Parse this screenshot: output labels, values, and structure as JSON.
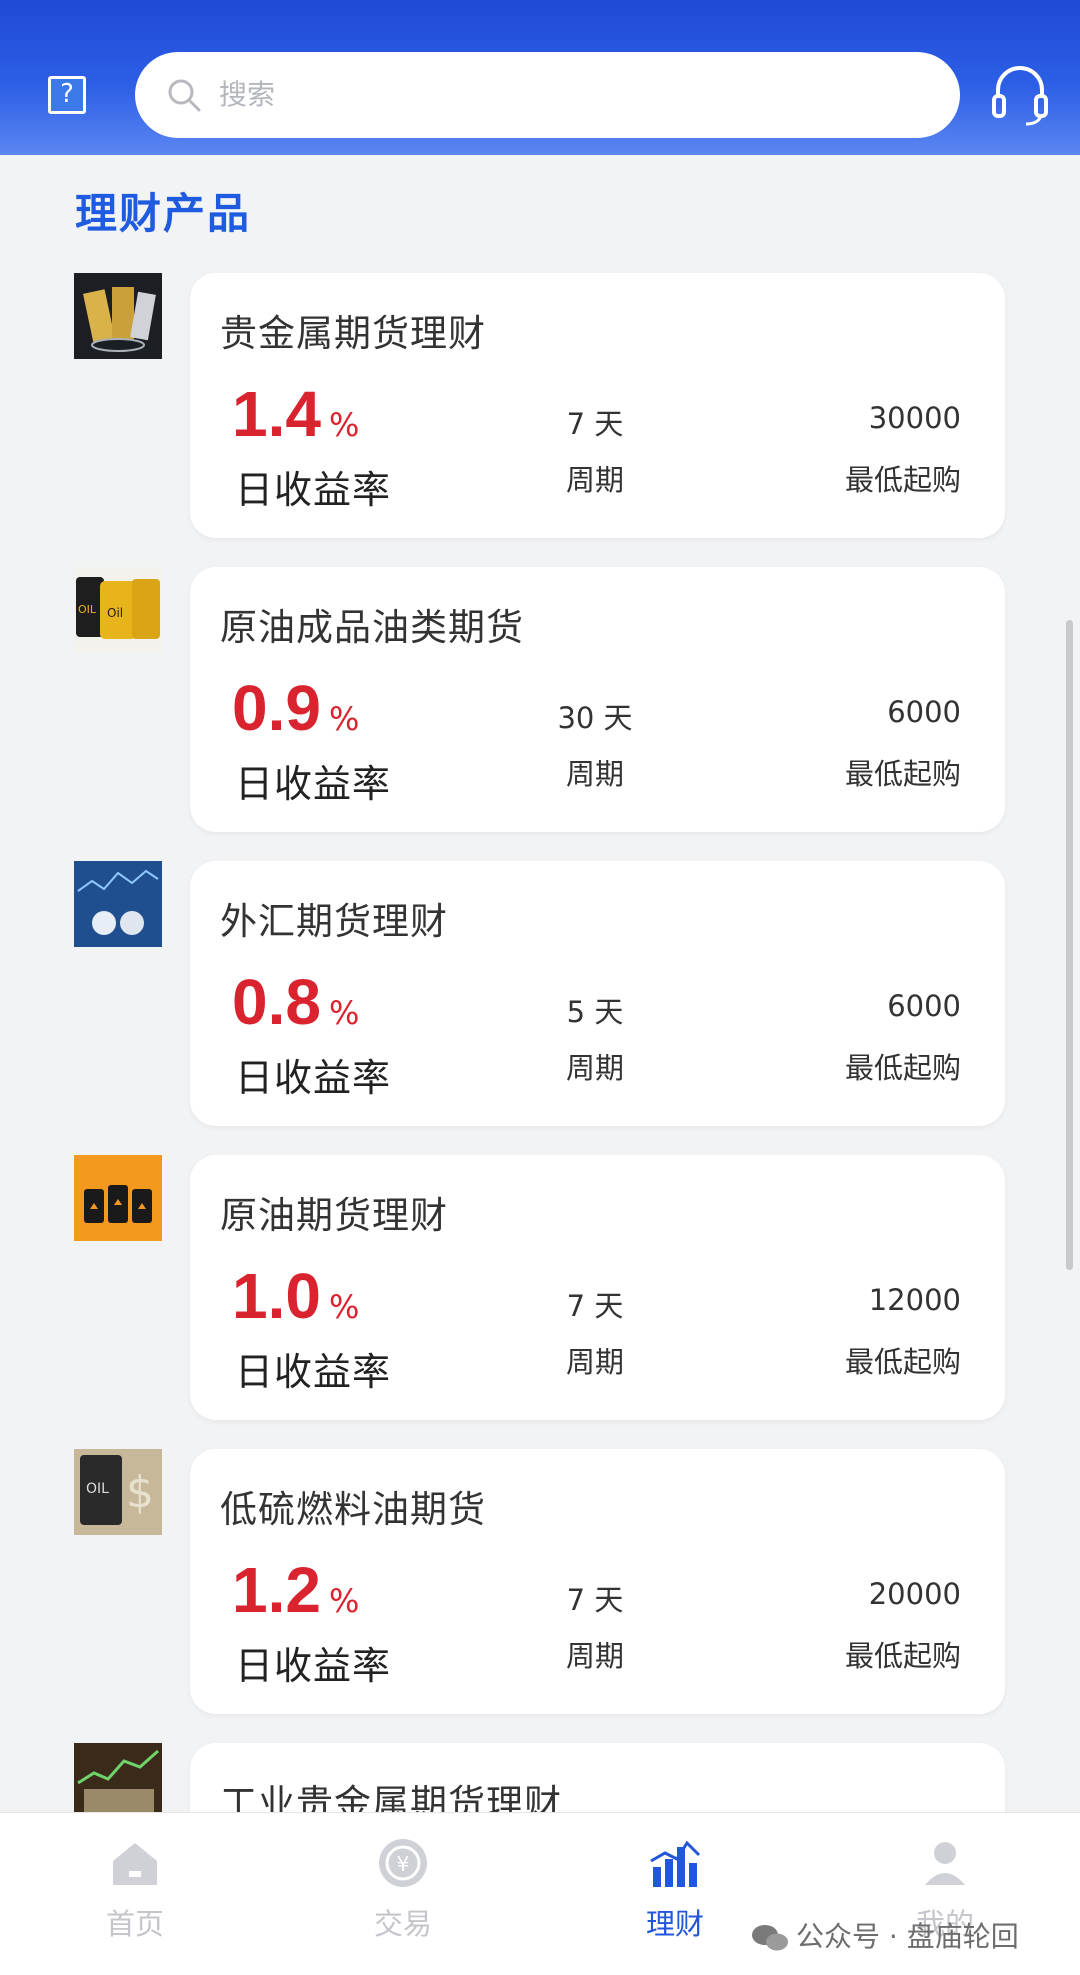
{
  "header": {
    "help_icon": "question-square-icon",
    "search_placeholder": "搜索",
    "service_icon": "headset-icon"
  },
  "section": {
    "title": "理财产品"
  },
  "products": [
    {
      "name": "贵金属期货理财",
      "rate": "1.4",
      "rate_unit": "%",
      "rate_label": "日收益率",
      "period": "7 天",
      "period_label": "周期",
      "min_purchase": "30000",
      "min_label": "最低起购",
      "thumb": "gold-bars-thumb"
    },
    {
      "name": "原油成品油类期货",
      "rate": "0.9",
      "rate_unit": "%",
      "rate_label": "日收益率",
      "period": "30 天",
      "period_label": "周期",
      "min_purchase": "6000",
      "min_label": "最低起购",
      "thumb": "oil-barrels-thumb"
    },
    {
      "name": "外汇期货理财",
      "rate": "0.8",
      "rate_unit": "%",
      "rate_label": "日收益率",
      "period": "5 天",
      "period_label": "周期",
      "min_purchase": "6000",
      "min_label": "最低起购",
      "thumb": "forex-thumb"
    },
    {
      "name": "原油期货理财",
      "rate": "1.0",
      "rate_unit": "%",
      "rate_label": "日收益率",
      "period": "7 天",
      "period_label": "周期",
      "min_purchase": "12000",
      "min_label": "最低起购",
      "thumb": "oil-drums-thumb"
    },
    {
      "name": "低硫燃料油期货",
      "rate": "1.2",
      "rate_unit": "%",
      "rate_label": "日收益率",
      "period": "7 天",
      "period_label": "周期",
      "min_purchase": "20000",
      "min_label": "最低起购",
      "thumb": "oil-dollar-thumb"
    },
    {
      "name": "工业贵金属期货理财",
      "thumb": "industrial-metal-thumb"
    }
  ],
  "nav": [
    {
      "label": "首页",
      "icon": "home-icon",
      "active": false
    },
    {
      "label": "交易",
      "icon": "yuan-coin-icon",
      "active": false
    },
    {
      "label": "理财",
      "icon": "chart-icon",
      "active": true
    },
    {
      "label": "我的",
      "icon": "user-icon",
      "active": false
    }
  ],
  "watermark": {
    "text": "公众号 · 盘庙轮回"
  },
  "colors": {
    "accent": "#1e5be0",
    "rate": "#d9232e",
    "header": "#2556e0"
  }
}
